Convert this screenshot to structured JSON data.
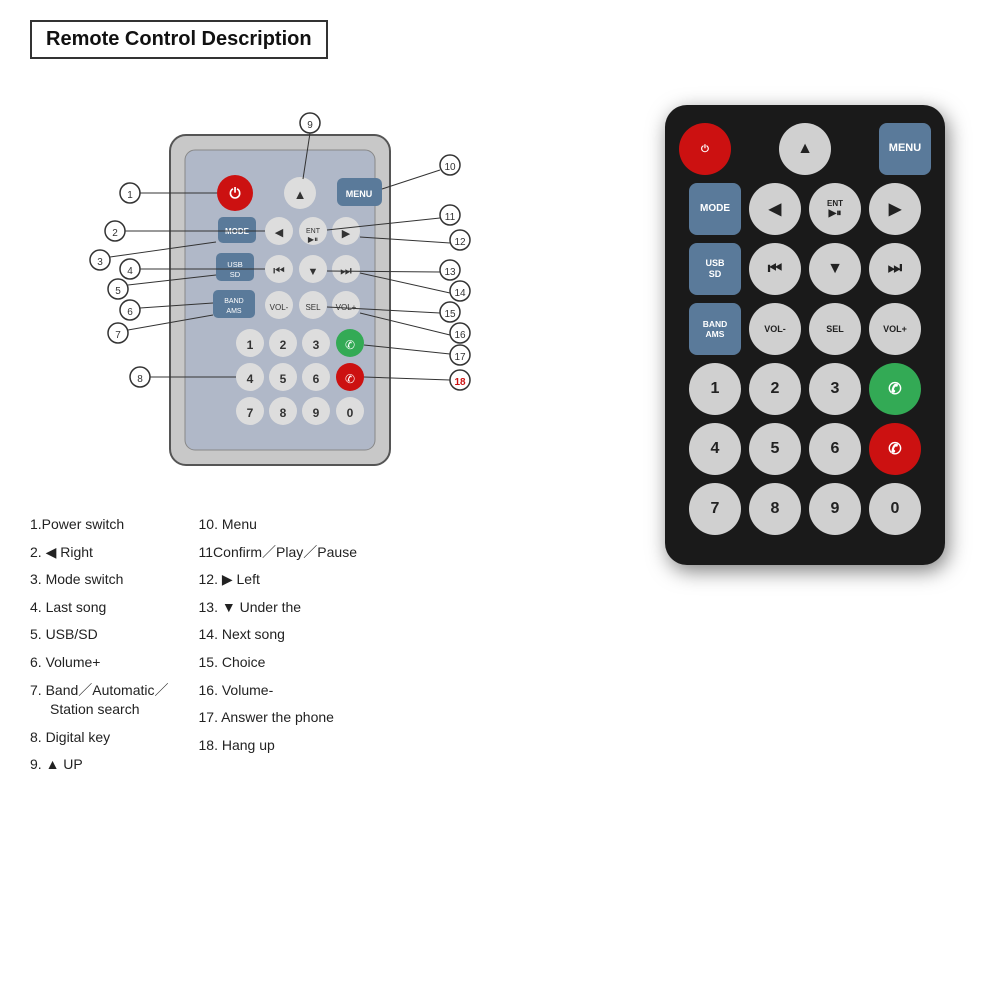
{
  "title": "Remote Control Description",
  "diagram": {
    "callouts": [
      {
        "num": "1",
        "label": "Power switch"
      },
      {
        "num": "2",
        "label": "◀ Right"
      },
      {
        "num": "3",
        "label": "Mode switch"
      },
      {
        "num": "4",
        "label": "Last song"
      },
      {
        "num": "5",
        "label": "USB/SD"
      },
      {
        "num": "6",
        "label": "Volume+"
      },
      {
        "num": "7",
        "label": "Band／Automatic／",
        "sub": "Station search"
      },
      {
        "num": "8",
        "label": "Digital key"
      },
      {
        "num": "9",
        "label": "▲ UP"
      }
    ],
    "calloutsRight": [
      {
        "num": "10",
        "label": "Menu"
      },
      {
        "num": "11",
        "label": "Confirm／Play／Pause"
      },
      {
        "num": "12",
        "label": "▶ Left"
      },
      {
        "num": "13",
        "label": "▼ Under the"
      },
      {
        "num": "14",
        "label": "Next song"
      },
      {
        "num": "15",
        "label": "Choice"
      },
      {
        "num": "16",
        "label": "Volume-"
      },
      {
        "num": "17",
        "label": "Answer the phone"
      },
      {
        "num": "18",
        "label": "Hang up"
      }
    ]
  },
  "remote": {
    "rows": [
      [
        {
          "label": "⏻",
          "type": "power"
        },
        {
          "label": "",
          "type": "empty"
        },
        {
          "label": "▲",
          "type": "round"
        },
        {
          "label": "",
          "type": "empty"
        },
        {
          "label": "MENU",
          "type": "rect"
        }
      ],
      [
        {
          "label": "MODE",
          "type": "rect"
        },
        {
          "label": "◀",
          "type": "round"
        },
        {
          "label": "ENT\n▶⏸",
          "type": "round"
        },
        {
          "label": "▶",
          "type": "round"
        },
        {
          "label": "",
          "type": "empty"
        }
      ],
      [
        {
          "label": "USB\nSD",
          "type": "rect"
        },
        {
          "label": "⏮",
          "type": "round"
        },
        {
          "label": "▼",
          "type": "round"
        },
        {
          "label": "⏭",
          "type": "round"
        },
        {
          "label": "",
          "type": "empty"
        }
      ],
      [
        {
          "label": "BAND\nAMS",
          "type": "rect"
        },
        {
          "label": "VOL-",
          "type": "round"
        },
        {
          "label": "SEL",
          "type": "round"
        },
        {
          "label": "VOL+",
          "type": "round"
        },
        {
          "label": "",
          "type": "empty"
        }
      ],
      [
        {
          "label": "1",
          "type": "round"
        },
        {
          "label": "2",
          "type": "round"
        },
        {
          "label": "3",
          "type": "round"
        },
        {
          "label": "",
          "type": "empty"
        },
        {
          "label": "✆",
          "type": "green"
        }
      ],
      [
        {
          "label": "4",
          "type": "round"
        },
        {
          "label": "5",
          "type": "round"
        },
        {
          "label": "6",
          "type": "round"
        },
        {
          "label": "",
          "type": "empty"
        },
        {
          "label": "✆",
          "type": "redphone"
        }
      ],
      [
        {
          "label": "7",
          "type": "round"
        },
        {
          "label": "8",
          "type": "round"
        },
        {
          "label": "9",
          "type": "round"
        },
        {
          "label": "0",
          "type": "round"
        },
        {
          "label": "",
          "type": "empty"
        }
      ]
    ]
  }
}
